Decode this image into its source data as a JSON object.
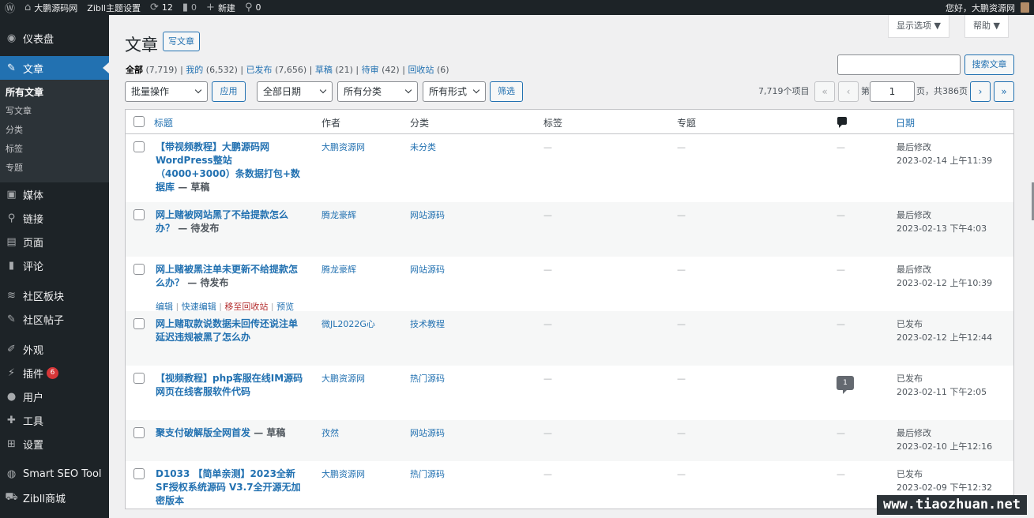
{
  "adminbar": {
    "site": "大鹏源码网",
    "theme": "Zibll主题设置",
    "updates": "12",
    "comments": "0",
    "new": "新建",
    "links": "0",
    "greeting": "您好，大鹏资源网"
  },
  "sidebar": {
    "dashboard": "仪表盘",
    "posts": "文章",
    "sub": [
      "所有文章",
      "写文章",
      "分类",
      "标签",
      "专题"
    ],
    "media": "媒体",
    "links": "链接",
    "pages": "页面",
    "comments": "评论",
    "forum_sections": "社区板块",
    "forum_posts": "社区帖子",
    "appearance": "外观",
    "plugins": "插件",
    "plugins_badge": "6",
    "users": "用户",
    "tools": "工具",
    "settings": "设置",
    "seo": "Smart SEO Tool",
    "shop": "Zibll商城"
  },
  "header": {
    "title": "文章",
    "add_new": "写文章",
    "screen_options": "显示选项 ▼",
    "help": "帮助 ▼"
  },
  "views": [
    {
      "label": "全部",
      "count": "(7,719)"
    },
    {
      "label": "我的",
      "count": "(6,532)"
    },
    {
      "label": "已发布",
      "count": "(7,656)"
    },
    {
      "label": "草稿",
      "count": "(21)"
    },
    {
      "label": "待审",
      "count": "(42)"
    },
    {
      "label": "回收站",
      "count": "(6)"
    }
  ],
  "search": {
    "button": "搜索文章",
    "placeholder": ""
  },
  "filters": {
    "bulk": "批量操作",
    "apply": "应用",
    "dates": "全部日期",
    "cats": "所有分类",
    "formats": "所有形式",
    "filter": "筛选"
  },
  "pagination": {
    "items": "7,719个项目",
    "first": "«",
    "prev": "‹",
    "page_label": "第",
    "page": "1",
    "total": "页，共386页",
    "next": "›",
    "last": "»"
  },
  "columns": {
    "title": "标题",
    "author": "作者",
    "category": "分类",
    "tags": "标签",
    "topic": "专题",
    "date": "日期"
  },
  "rows": [
    {
      "title": "【带视频教程】大鹏源码网WordPress整站（4000+3000）条数据打包+数据库",
      "state": " — 草稿",
      "author": "大鹏资源网",
      "category": "未分类",
      "tags": "—",
      "topic": "—",
      "comments": "—",
      "date_status": "最后修改",
      "date": "2023-02-14 上午11:39"
    },
    {
      "title": "网上赌被网站黑了不给提款怎么办？",
      "state": " — 待发布",
      "author": "腾龙豪辉",
      "category": "网站源码",
      "tags": "—",
      "topic": "—",
      "comments": "—",
      "date_status": "最后修改",
      "date": "2023-02-13 下午4:03"
    },
    {
      "title": "网上赌被黑注单未更新不给提款怎么办？",
      "state": " — 待发布",
      "author": "腾龙豪辉",
      "category": "网站源码",
      "tags": "—",
      "topic": "—",
      "comments": "—",
      "date_status": "最后修改",
      "date": "2023-02-12 上午10:39"
    },
    {
      "title": "网上赌取款说数据未回传还说注单延迟违规被黑了怎么办",
      "state": "",
      "author": "微JL2022G心",
      "category": "技术教程",
      "tags": "—",
      "topic": "—",
      "comments": "—",
      "date_status": "已发布",
      "date": "2023-02-12 上午12:44"
    },
    {
      "title": "【视频教程】php客服在线IM源码网页在线客服软件代码",
      "state": "",
      "author": "大鹏资源网",
      "category": "热门源码",
      "tags": "—",
      "topic": "—",
      "comments": "1",
      "date_status": "已发布",
      "date": "2023-02-11 下午2:05"
    },
    {
      "title": "聚支付破解版全网首发",
      "state": " — 草稿",
      "author": "孜然",
      "category": "网站源码",
      "tags": "—",
      "topic": "—",
      "comments": "—",
      "date_status": "最后修改",
      "date": "2023-02-10 上午12:16"
    },
    {
      "title": "D1033 【简单亲测】2023全新SF授权系统源码 V3.7全开源无加密版本",
      "state": "",
      "author": "大鹏资源网",
      "category": "热门源码",
      "tags": "—",
      "topic": "—",
      "comments": "—",
      "date_status": "已发布",
      "date": "2023-02-09 下午12:32"
    }
  ],
  "row_actions": {
    "edit": "编辑",
    "quick_edit": "快速编辑",
    "trash": "移至回收站",
    "preview": "预览"
  },
  "watermark": "www.tiaozhuan.net"
}
